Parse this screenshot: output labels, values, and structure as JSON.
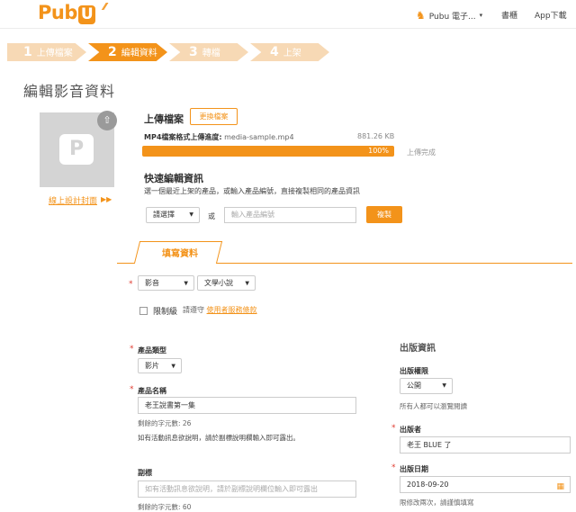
{
  "header": {
    "logo": "Pub",
    "logo_badge": "U",
    "user_label": "Pubu 電子...",
    "user_caret": "▾",
    "links": [
      "書櫃",
      "App下載"
    ]
  },
  "steps": [
    {
      "num": "1",
      "label": "上傳檔案",
      "active": false
    },
    {
      "num": "2",
      "label": "編輯資料",
      "active": true
    },
    {
      "num": "3",
      "label": "轉檔",
      "active": false
    },
    {
      "num": "4",
      "label": "上架",
      "active": false
    }
  ],
  "page_title": "編輯影音資料",
  "cover": {
    "placeholder_glyph": "P",
    "link_label": "線上設計封面",
    "link_arrow": "▶▶"
  },
  "upload": {
    "label": "上傳檔案",
    "change_button": "更換檔案",
    "progress_label": "MP4檔案格式上傳進度:",
    "filename": "media-sample.mp4",
    "file_size": "881.26 KB",
    "progress_percent": 100,
    "progress_text": "100%",
    "status": "上傳完成"
  },
  "quick_edit": {
    "title": "快速編輯資訊",
    "description": "選一個最近上架的產品，或輸入產品編號，直接複製相同的產品資訊",
    "select_value": "請選擇",
    "or_text": "或",
    "input_placeholder": "輸入產品編號",
    "copy_button": "複製"
  },
  "tab_label": "填寫資料",
  "category": {
    "type_value": "影音",
    "genre_value": "文學小說"
  },
  "restricted": {
    "label": "限制級",
    "note": "請遵守",
    "link": "使用者服務條款"
  },
  "product_type": {
    "label": "產品類型",
    "value": "影片"
  },
  "product_name": {
    "label": "產品名稱",
    "value": "老王說書第一集",
    "remaining": "剩餘的字元數: 26",
    "hint": "如有活動訊息欲說明，請於副標說明欄輸入即可露出。"
  },
  "subtitle": {
    "label": "副標",
    "placeholder": "如有活動訊息欲說明，請於副標說明欄位輸入即可露出",
    "remaining": "剩餘的字元數: 60"
  },
  "publish": {
    "section_title": "出版資訊",
    "permission_label": "出版權限",
    "permission_value": "公開",
    "permission_hint": "所有人都可以瀏覽閱讀",
    "publisher_label": "出版者",
    "publisher_value": "老王 BLUE 了",
    "date_label": "出版日期",
    "date_value": "2018-09-20",
    "date_hint": "限修改兩次，請謹慎填寫"
  },
  "colors": {
    "accent": "#f3931a",
    "required": "#e03c31"
  }
}
